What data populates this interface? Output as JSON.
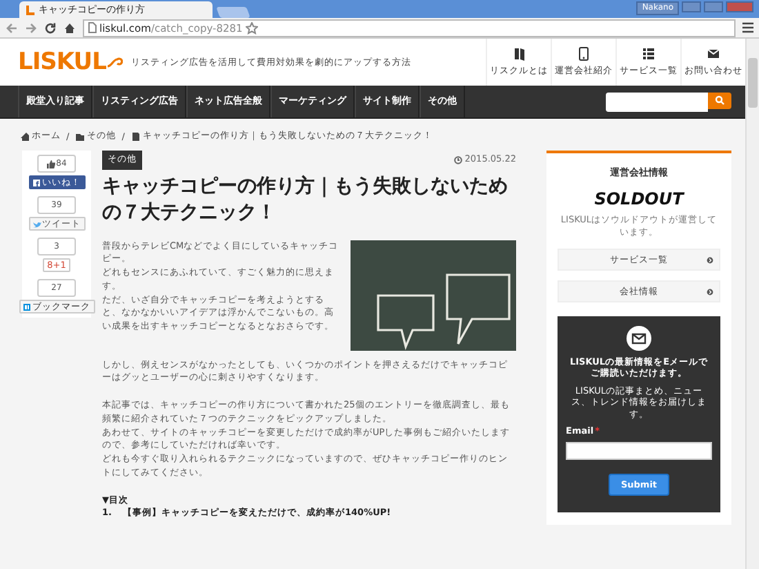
{
  "browser": {
    "tab_title": "キャッチコピーの作り方",
    "user": "Nakano",
    "url_host": "liskul.com",
    "url_path": "/catch_copy-8281"
  },
  "header": {
    "logo": "LISKUL",
    "tagline": "リスティング広告を活用して費用対効果を劇的にアップする方法",
    "links": [
      {
        "label": "リスクルとは",
        "kind": "book"
      },
      {
        "label": "運営会社紹介",
        "kind": "phone"
      },
      {
        "label": "サービス一覧",
        "kind": "list"
      },
      {
        "label": "お問い合わせ",
        "kind": "mail"
      }
    ]
  },
  "nav": {
    "items": [
      "殿堂入り記事",
      "リスティング広告",
      "ネット広告全般",
      "マーケティング",
      "サイト制作",
      "その他"
    ]
  },
  "breadcrumb": [
    {
      "label": "ホーム",
      "kind": "home"
    },
    {
      "separator": "/",
      "label": "その他",
      "kind": "folder"
    },
    {
      "separator": "/",
      "label": "キャッチコピーの作り方｜もう失敗しないための７大テクニック！",
      "kind": "page"
    }
  ],
  "share": [
    {
      "count": "84",
      "label": "いいね！",
      "kind": "facebook"
    },
    {
      "count": "39",
      "label": "ツイート",
      "kind": "twitter"
    },
    {
      "count": "3",
      "label": "8+1",
      "kind": "google"
    },
    {
      "count": "27",
      "label": "ブックマーク",
      "kind": "hatena"
    }
  ],
  "article": {
    "category": "その他",
    "date": "2015.05.22",
    "title": "キャッチコピーの作り方｜もう失敗しないための７大テクニック！",
    "paragraphs": [
      [
        "普段からテレビCMなどでよく目にしているキャッチコピー。",
        "どれもセンスにあふれていて、すごく魅力的に思えます。",
        "ただ、いざ自分でキャッチコピーを考えようとすると、なかなかいいアイデアは浮かんでこないもの。高い成果を出すキャッチコピーとなるとなおさらです。"
      ],
      [
        "しかし、例えセンスがなかったとしても、いくつかのポイントを押さえるだけでキャッチコピーはグッとユーザーの心に刺さりやすくなります。"
      ],
      [
        "本記事では、キャッチコピーの作り方について書かれた25個のエントリーを徹底調査し、最も頻繁に紹介されていた７つのテクニックをピックアップしました。",
        "あわせて、サイトのキャッチコピーを変更しただけで成約率がUPした事例もご紹介いたしますので、参考にしていただければ幸いです。",
        "どれも今すぐ取り入れられるテクニックになっていますので、ぜひキャッチコピー作りのヒントにしてみてください。"
      ]
    ],
    "toc_heading": "▼目次",
    "toc": [
      {
        "number": "1.",
        "text": "【事例】キャッチコピーを変えただけで、成約率が140%UP!"
      }
    ]
  },
  "sidebar": {
    "heading": "運営会社情報",
    "logo": "SOLDOUT",
    "note": "LISKULはソウルドアウトが運営しています。",
    "links": [
      "サービス一覧",
      "会社情報"
    ],
    "newsletter": {
      "title": "LISKULの最新情報をEメールでご購読いただけます。",
      "description": "LISKULの記事まとめ、ニュース、トレンド情報をお届けします。",
      "email_label": "Email",
      "required_mark": "*",
      "submit": "Submit"
    }
  }
}
